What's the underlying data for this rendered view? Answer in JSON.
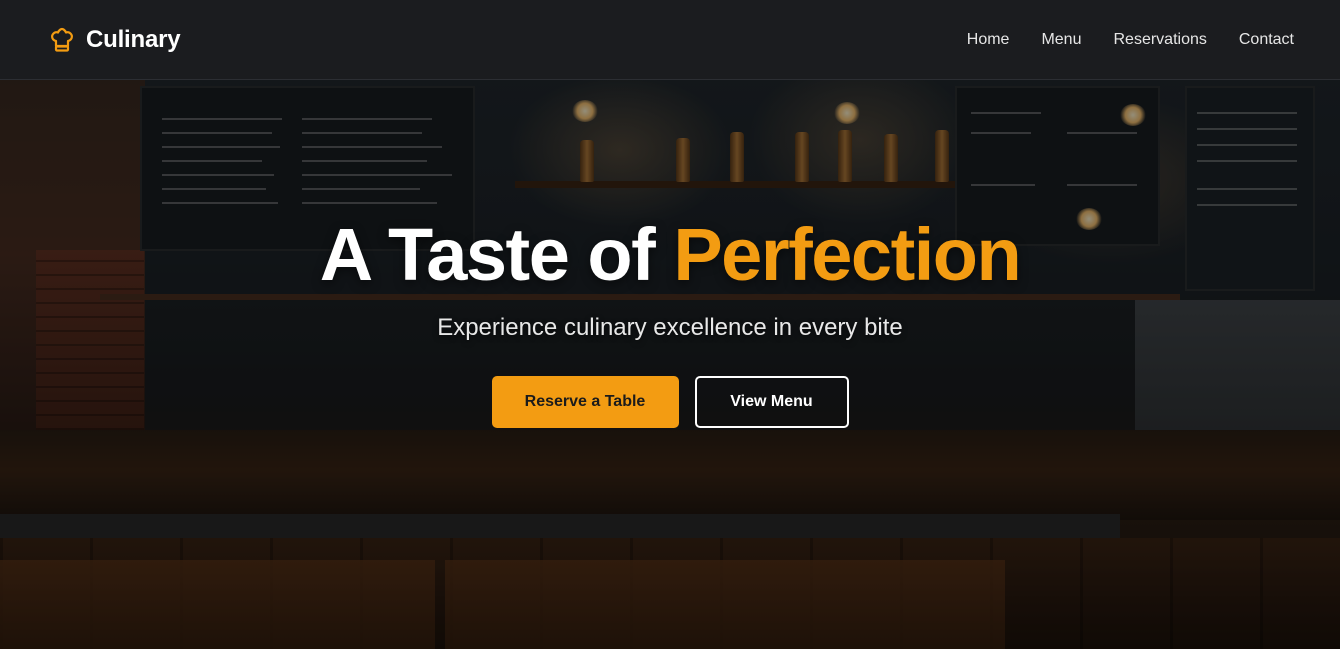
{
  "header": {
    "brand_name": "Culinary",
    "brand_icon": "chef-hat-icon",
    "nav": [
      {
        "label": "Home"
      },
      {
        "label": "Menu"
      },
      {
        "label": "Reservations"
      },
      {
        "label": "Contact"
      }
    ]
  },
  "hero": {
    "headline_prefix": "A Taste of",
    "headline_accent": "Perfection",
    "subheadline": "Experience culinary excellence in every bite",
    "primary_cta": "Reserve a Table",
    "secondary_cta": "View Menu",
    "background": "bar-interior-photo"
  },
  "colors": {
    "accent": "#f39c12",
    "header_bg": "#1b1c1f",
    "text": "#ffffff"
  }
}
